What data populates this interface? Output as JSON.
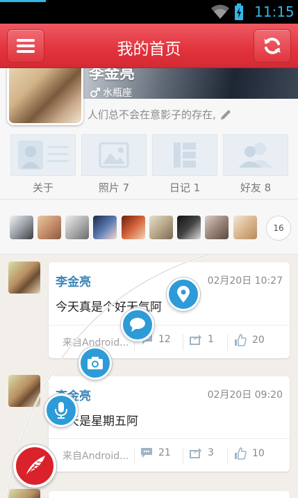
{
  "status_bar": {
    "time": "11:15"
  },
  "header": {
    "title": "我的首页",
    "menu_icon": "menu-icon",
    "refresh_icon": "refresh-icon"
  },
  "profile": {
    "name_partial": "李金亮",
    "zodiac": "水瓶座",
    "signature": "人们总不会在意影子的存在,"
  },
  "tiles": [
    {
      "label": "关于",
      "icon": "contact-card-icon"
    },
    {
      "label": "照片 7",
      "icon": "photo-icon"
    },
    {
      "label": "日记 1",
      "icon": "diary-icon"
    },
    {
      "label": "好友 8",
      "icon": "friends-icon"
    }
  ],
  "friends": {
    "count": "16"
  },
  "posts": [
    {
      "author": "李金亮",
      "time": "02月20日 10:27",
      "text": "今天真是个好天气阿",
      "source": "来自Android...",
      "comments": "12",
      "reposts": "1",
      "likes": "20"
    },
    {
      "author": "李金亮",
      "time": "02月20日 09:20",
      "text": "今天是星期五阿",
      "source": "来自Android...",
      "comments": "21",
      "reposts": "3",
      "likes": "10"
    }
  ],
  "arc_menu": [
    "location-icon",
    "chat-bubble-icon",
    "camera-icon",
    "microphone-icon"
  ],
  "colors": {
    "brand_red": "#e2323d",
    "accent_blue": "#2d9bd8",
    "author_blue": "#3c86b8"
  }
}
